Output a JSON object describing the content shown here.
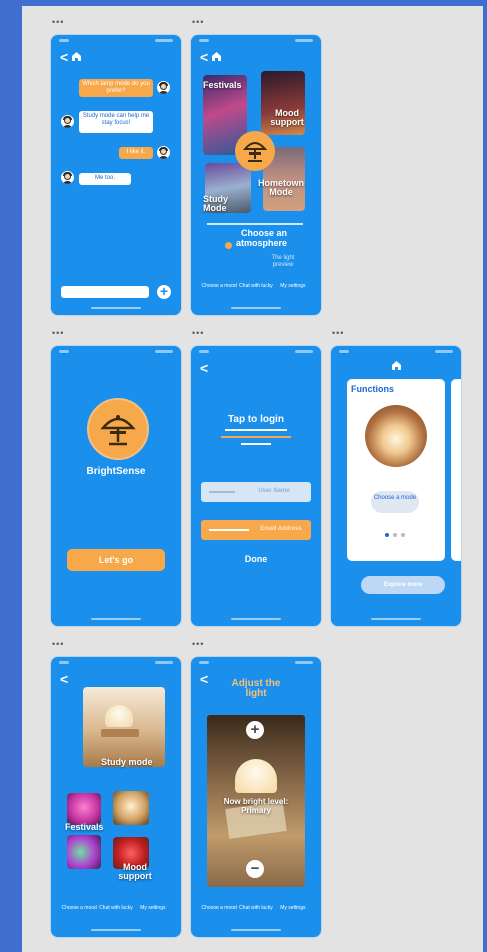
{
  "colors": {
    "phone_bg": "#1a90ec",
    "accent": "#f6a84a",
    "canvas": "#e3e3e3",
    "frame": "#3e6fcf"
  },
  "icons": [
    "back-arrow-icon",
    "home-icon",
    "plus-icon",
    "minus-icon",
    "lamp-icon",
    "avatar-icon"
  ],
  "dots": "•••",
  "back_glyph": "<",
  "chat": {
    "messages": [
      {
        "from": "user",
        "text": "Which lamp mode do you prefer?"
      },
      {
        "from": "bot",
        "text": "Study mode can help me stay focus!"
      },
      {
        "from": "user",
        "text": "I like it."
      },
      {
        "from": "bot",
        "text": "Me too."
      }
    ],
    "add_glyph": "+"
  },
  "atmosphere": {
    "tiles": [
      "Festivals",
      "Mood support",
      "Study Mode",
      "Hometown Mode"
    ],
    "heading": "Choose an atmosphere",
    "preview": "The light preview"
  },
  "nav": {
    "items": [
      "Choose a mood",
      "Chat with lucky",
      "My settings"
    ]
  },
  "splash": {
    "app_name": "BrightSense",
    "cta": "Let's go"
  },
  "login": {
    "title": "Tap to login",
    "username_placeholder": "User Name",
    "email_placeholder": "Email Address",
    "done": "Done"
  },
  "functions": {
    "title": "Functions",
    "choose_label": "Choose a mode",
    "bottom_button": "Explore more"
  },
  "modes": {
    "study": "Study mode",
    "festivals": "Festivals",
    "mood": "Mood support"
  },
  "adjust": {
    "title": "Adjust the light",
    "level": "Now bright level: Primary",
    "plus": "+",
    "minus": "−"
  }
}
